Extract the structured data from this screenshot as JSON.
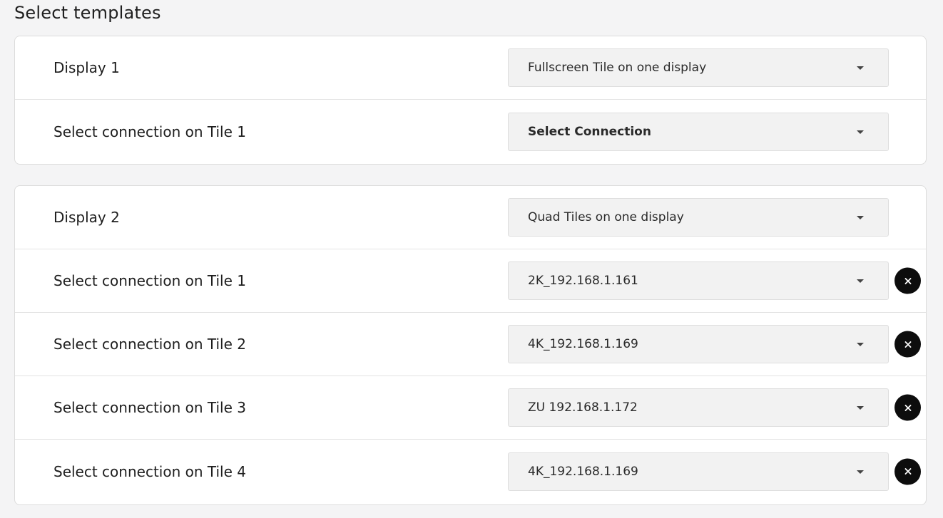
{
  "page": {
    "title": "Select templates"
  },
  "displays": [
    {
      "label": "Display 1",
      "template": "Fullscreen Tile on one display",
      "tiles": [
        {
          "label": "Select connection on Tile 1",
          "value": "Select Connection",
          "placeholder": true
        }
      ]
    },
    {
      "label": "Display 2",
      "template": "Quad Tiles on one display",
      "tiles": [
        {
          "label": "Select connection on Tile 1",
          "value": "2K_192.168.1.161"
        },
        {
          "label": "Select connection on Tile 2",
          "value": "4K_192.168.1.169"
        },
        {
          "label": "Select connection on Tile 3",
          "value": "ZU 192.168.1.172"
        },
        {
          "label": "Select connection on Tile 4",
          "value": "4K_192.168.1.169"
        }
      ]
    }
  ],
  "icons": {
    "dropdown": "chevron-down-icon",
    "clear": "close-icon"
  },
  "colors": {
    "background": "#f4f4f5",
    "card": "#ffffff",
    "select": "#f2f2f2",
    "clear_button": "#0d0d0d"
  }
}
